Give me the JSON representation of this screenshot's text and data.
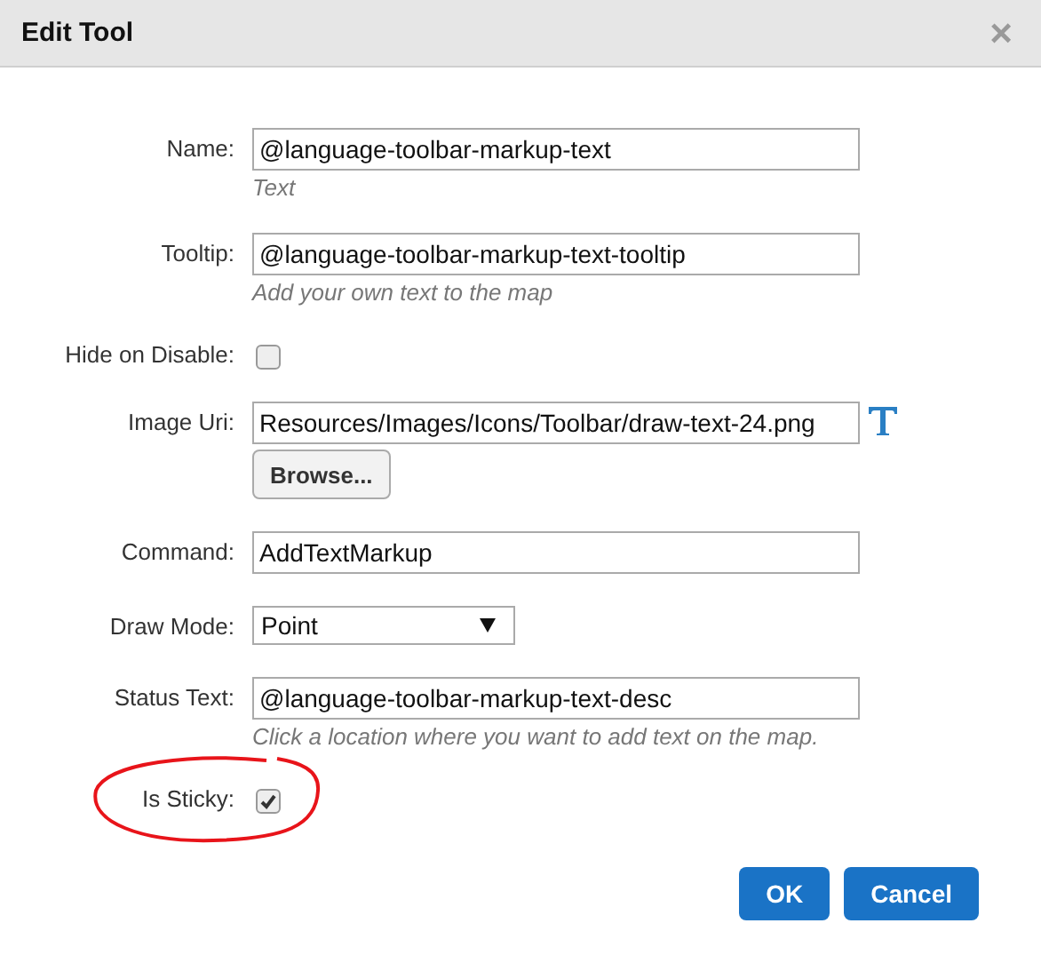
{
  "window": {
    "title": "Edit Tool",
    "close": "×"
  },
  "fields": [
    {
      "kind": "text",
      "label": "Name:",
      "value": "@language-toolbar-markup-text",
      "hint": "Text",
      "circled": false
    },
    {
      "kind": "text",
      "label": "Tooltip:",
      "value": "@language-toolbar-markup-text-tooltip",
      "hint": "Add your own text to the map",
      "circled": false
    },
    {
      "kind": "checkbox",
      "label": "Hide on Disable:",
      "checked": false,
      "circled": false
    },
    {
      "kind": "image",
      "label": "Image Uri:",
      "value": "Resources/Images/Icons/Toolbar/draw-text-24.png",
      "button": "Browse...",
      "circled": false
    },
    {
      "kind": "text",
      "label": "Command:",
      "value": "AddTextMarkup",
      "circled": false
    },
    {
      "kind": "select",
      "label": "Draw Mode:",
      "value": "Point",
      "circled": false
    },
    {
      "kind": "text",
      "label": "Status Text:",
      "value": "@language-toolbar-markup-text-desc",
      "hint": "Click a location where you want to add text on the map.",
      "circled": false
    },
    {
      "kind": "checkbox",
      "label": "Is Sticky:",
      "checked": true,
      "circled": true
    }
  ],
  "buttons": [
    "OK",
    "Cancel"
  ]
}
